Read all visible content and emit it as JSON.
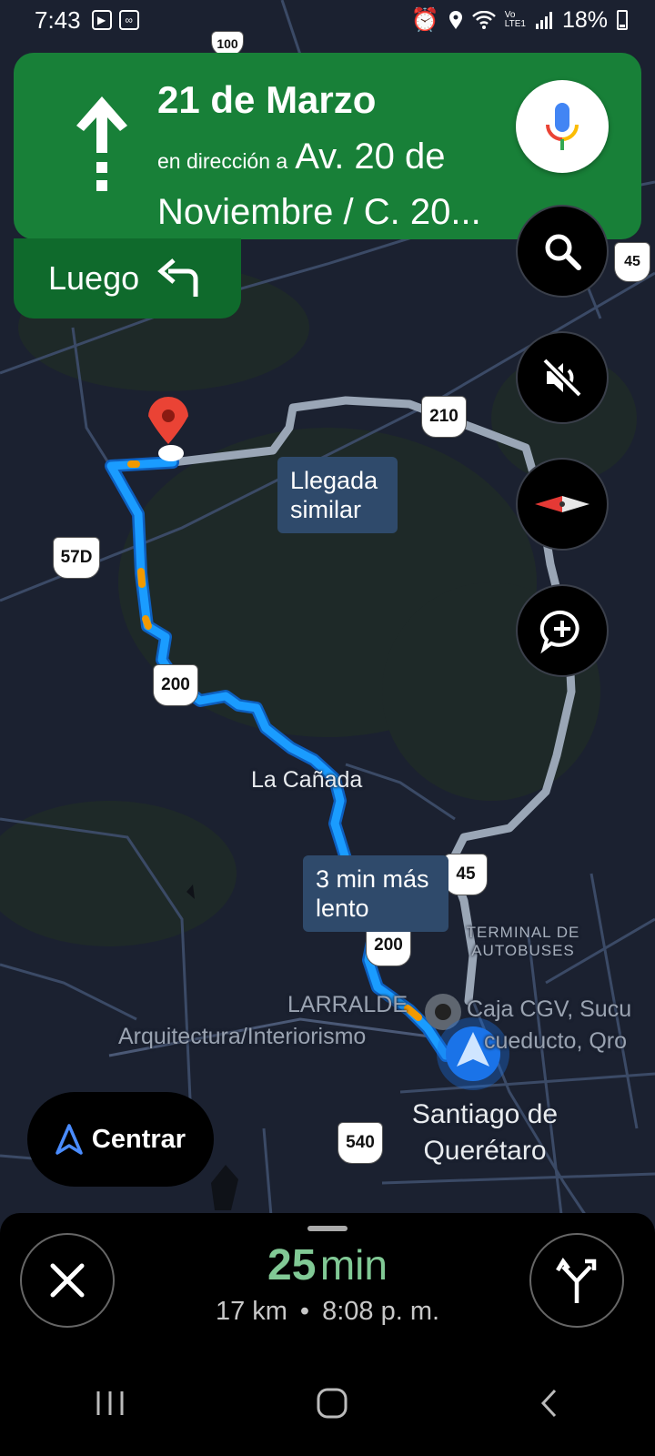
{
  "status_bar": {
    "time": "7:43",
    "battery": "18%",
    "left_icons": [
      "play-store-icon",
      "voicemail-icon"
    ],
    "right_icons": [
      "alarm-icon",
      "location-icon",
      "wifi-icon",
      "volte-icon",
      "signal-icon",
      "battery-icon"
    ]
  },
  "banner": {
    "street": "21 de Marzo",
    "toward_prefix": "en dirección a",
    "toward_dest": "Av. 20 de Noviembre / C. 20...",
    "maneuver_icon": "straight-arrow-icon",
    "then_label": "Luego",
    "then_icon": "turn-left-arrow-icon"
  },
  "buttons": {
    "mic_icon": "mic-icon",
    "search_icon": "search-icon",
    "mute_icon": "sound-off-icon",
    "compass_icon": "compass-icon",
    "report_icon": "add-report-icon",
    "recenter_label": "Centrar"
  },
  "map": {
    "callout_similar": "Llegada similar",
    "callout_slower": "3 min más lento",
    "place_canada": "La Cañada",
    "place_larralde": "LARRALDE",
    "place_arq": "Arquitectura/Interiorismo",
    "place_caja": "Caja CGV, Sucu",
    "place_acueducto": "cueducto, Qro",
    "place_terminal": "TERMINAL DE AUTOBUSES",
    "place_city": "Santiago de Querétaro",
    "shields": {
      "s100": "100",
      "s45a": "45",
      "s210": "210",
      "s57d": "57D",
      "s200a": "200",
      "s45b": "45",
      "s200b": "200",
      "s540": "540"
    }
  },
  "trip": {
    "eta_number": "25",
    "eta_unit": "min",
    "distance": "17 km",
    "separator": "•",
    "arrival": "8:08 p. m."
  },
  "colors": {
    "banner_green": "#188038",
    "route_blue": "#1a9cff",
    "alt_route_gray": "#8d98a8",
    "eta_green": "#81c995"
  }
}
